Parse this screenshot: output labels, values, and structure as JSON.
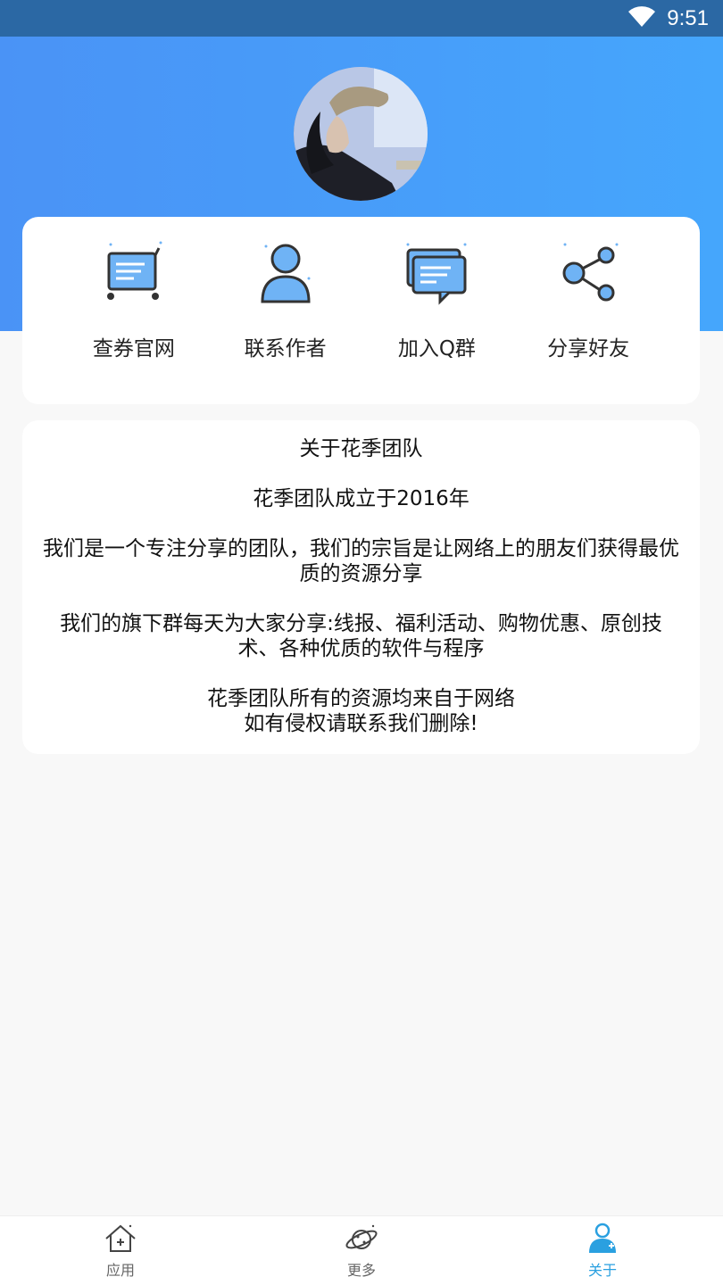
{
  "status_bar": {
    "time": "9:51"
  },
  "actions": [
    {
      "label": "查券官网",
      "icon": "cart-icon"
    },
    {
      "label": "联系作者",
      "icon": "person-icon"
    },
    {
      "label": "加入Q群",
      "icon": "chat-icon"
    },
    {
      "label": "分享好友",
      "icon": "share-icon"
    }
  ],
  "about": {
    "title": "关于花季团队",
    "founded": "花季团队成立于2016年",
    "mission_line1": "我们是一个专注分享的团队，我们的宗旨是让网络上的朋友们获得最优",
    "mission_line2": "质的资源分享",
    "groups_line1": "我们的旗下群每天为大家分享:线报、福利活动、购物优惠、原创技",
    "groups_line2": "术、各种优质的软件与程序",
    "disclaimer_line1": "花季团队所有的资源均来自于网络",
    "disclaimer_line2": "如有侵权请联系我们删除!"
  },
  "tabs": [
    {
      "label": "应用",
      "icon": "home-icon",
      "active": false
    },
    {
      "label": "更多",
      "icon": "planet-icon",
      "active": false
    },
    {
      "label": "关于",
      "icon": "user-icon",
      "active": true
    }
  ],
  "colors": {
    "header_gradient_start": "#4a93f6",
    "header_gradient_end": "#45a6fc",
    "status_bar": "#2b68a4",
    "active_tab": "#2aa0e0",
    "icon_fill": "#6fb3f5"
  }
}
